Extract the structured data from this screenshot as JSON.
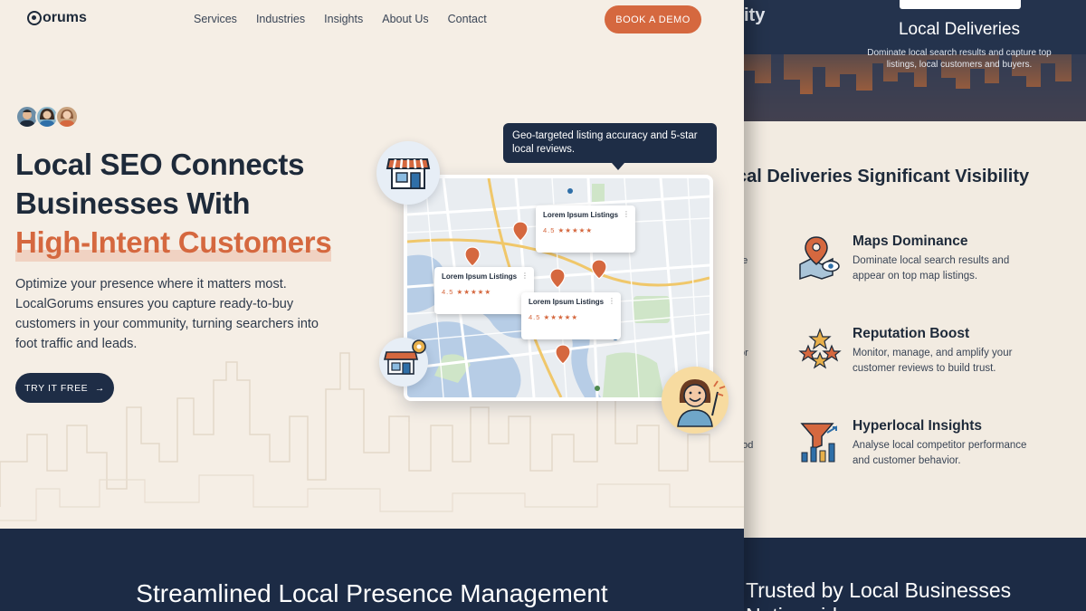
{
  "brand": {
    "logo_text": "orums"
  },
  "nav": {
    "items": [
      "Services",
      "Industries",
      "Insights",
      "About Us",
      "Contact"
    ]
  },
  "header": {
    "cta_label": "BOOK A DEMO"
  },
  "hero": {
    "headline_line1": "Local SEO Connects",
    "headline_line2": "Businesses With",
    "headline_accent": "High-Intent Customers",
    "subtext": "Optimize your presence where it matters most. LocalGorums ensures you capture ready-to-buy customers in your community, turning searchers into foot traffic and leads.",
    "cta_label": "TRY IT FREE",
    "cta_arrow": "→",
    "tooltip": "Geo-targeted listing accuracy and 5-star local reviews."
  },
  "map_listings": [
    {
      "name": "Lorem Ipsum Listings",
      "rating": "4.5 ★★★★★",
      "kebab": "⋮"
    },
    {
      "name": "Lorem Ipsum Listings",
      "rating": "4.5 ★★★★★",
      "kebab": "⋮"
    },
    {
      "name": "Lorem Ipsum Listings",
      "rating": "4.5 ★★★★★",
      "kebab": "⋮"
    }
  ],
  "bottom_section": {
    "title": "Streamlined Local Presence Management"
  },
  "right_panel": {
    "hero_partial_word": "ity",
    "hero_title": "Local Deliveries",
    "hero_desc": "Dominate local search results and capture top listings, local customers and buyers.",
    "section_heading": "cal Deliveries Significant Visibility",
    "left_stubs": [
      "pe",
      "tor",
      "ood"
    ],
    "features": [
      {
        "icon": "map-pin-eye-icon",
        "title": "Maps Dominance",
        "desc": "Dominate local search results and appear on top map listings."
      },
      {
        "icon": "stars-icon",
        "title": "Reputation Boost",
        "desc": "Monitor, manage, and amplify your customer reviews to build trust."
      },
      {
        "icon": "funnel-chart-icon",
        "title": "Hyperlocal Insights",
        "desc": "Analyse local competitor performance and customer behavior."
      }
    ],
    "footer_title": "Trusted by Local Businesses Nationwide"
  },
  "colors": {
    "accent": "#d5683f",
    "navy": "#1e2d46",
    "cream": "#f5eee5",
    "map_water": "#b7cde6",
    "map_park": "#cfe5c8"
  }
}
